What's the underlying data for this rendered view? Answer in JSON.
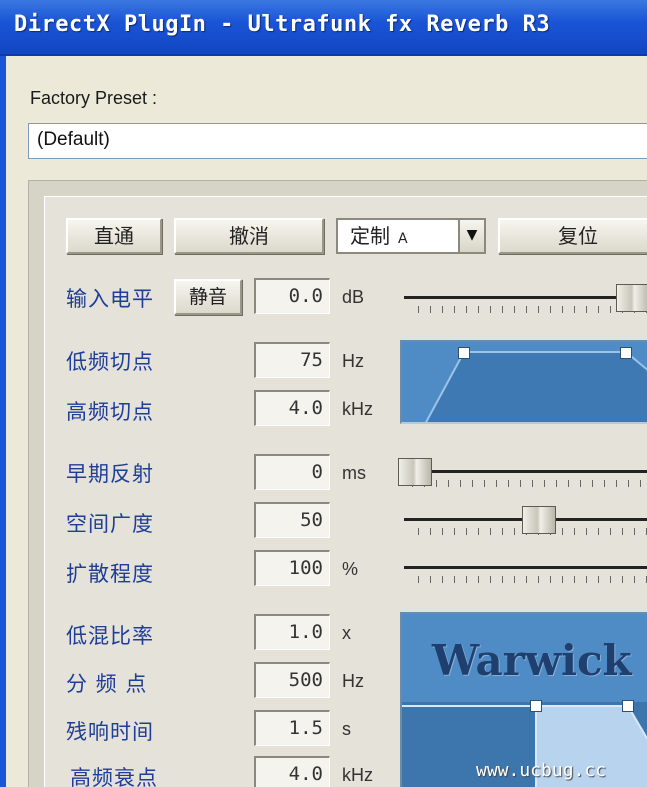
{
  "window": {
    "title": "DirectX PlugIn - Ultrafunk fx Reverb R3"
  },
  "preset": {
    "label": "Factory Preset :",
    "value": "(Default)"
  },
  "toolbar": {
    "bypass_label": "直通",
    "undo_label": "撤消",
    "custom_label": "定制",
    "custom_slot": "A",
    "reset_label": "复位"
  },
  "params": {
    "input_level": {
      "label": "输入电平",
      "mute_label": "静音",
      "value": "0.0",
      "unit": "dB"
    },
    "low_cut": {
      "label": "低频切点",
      "value": "75",
      "unit": "Hz"
    },
    "high_cut": {
      "label": "高频切点",
      "value": "4.0",
      "unit": "kHz"
    },
    "early_reflections": {
      "label": "早期反射",
      "value": "0",
      "unit": "ms"
    },
    "room_width": {
      "label": "空间广度",
      "value": "50",
      "unit": ""
    },
    "diffusion": {
      "label": "扩散程度",
      "value": "100",
      "unit": "%"
    },
    "low_mix_ratio": {
      "label": "低混比率",
      "value": "1.0",
      "unit": "x"
    },
    "crossover": {
      "label": "分 频 点",
      "value": "500",
      "unit": "Hz"
    },
    "decay_time": {
      "label": "残响时间",
      "value": "1.5",
      "unit": "s"
    },
    "high_damp": {
      "label": "高频衰点",
      "value": "4.0",
      "unit": "kHz"
    }
  },
  "brand": {
    "text": "Warwick"
  },
  "watermark": {
    "text": "www.ucbug.cc"
  },
  "icons": {
    "combo_arrow": "dropdown-arrow-icon"
  },
  "colors": {
    "titlebar": "#1a55d6",
    "label_blue": "#1f3e96",
    "graph_blue": "#4f8bc4"
  }
}
